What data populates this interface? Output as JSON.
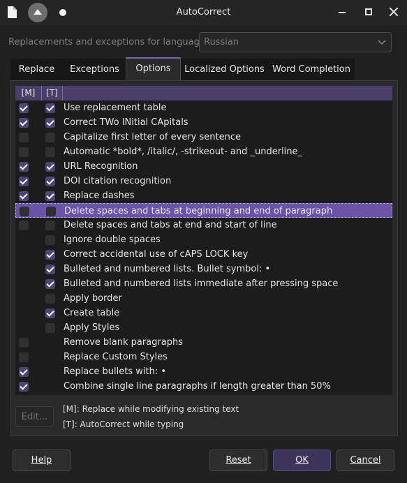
{
  "window": {
    "title": "AutoCorrect"
  },
  "language": {
    "label": "Replacements and exceptions for language:",
    "value": "Russian"
  },
  "tabs": [
    {
      "label": "Replace",
      "active": false
    },
    {
      "label": "Exceptions",
      "active": false
    },
    {
      "label": "Options",
      "active": true
    },
    {
      "label": "Localized Options",
      "active": false
    },
    {
      "label": "Word Completion",
      "active": false
    }
  ],
  "options": {
    "col_m": "[M]",
    "col_t": "[T]",
    "rows": [
      {
        "label": "Use replacement table",
        "m": true,
        "t": true
      },
      {
        "label": "Correct TWo INitial CApitals",
        "m": true,
        "t": true
      },
      {
        "label": "Capitalize first letter of every sentence",
        "m": false,
        "t": false
      },
      {
        "label": "Automatic *bold*, /italic/, -strikeout- and _underline_",
        "m": false,
        "t": false
      },
      {
        "label": "URL Recognition",
        "m": true,
        "t": true
      },
      {
        "label": "DOI citation recognition",
        "m": true,
        "t": true
      },
      {
        "label": "Replace dashes",
        "m": true,
        "t": true
      },
      {
        "label": "Delete spaces and tabs at beginning and end of paragraph",
        "m": false,
        "t": false,
        "selected": true
      },
      {
        "label": "Delete spaces and tabs at end and start of line",
        "m": false,
        "t": false
      },
      {
        "label": "Ignore double spaces",
        "m": null,
        "t": false
      },
      {
        "label": "Correct accidental use of cAPS LOCK key",
        "m": null,
        "t": true
      },
      {
        "label": "Bulleted and numbered lists. Bullet symbol: •",
        "m": null,
        "t": true
      },
      {
        "label": "Bulleted and numbered lists immediate after pressing space",
        "m": null,
        "t": true
      },
      {
        "label": "Apply border",
        "m": null,
        "t": false
      },
      {
        "label": "Create table",
        "m": null,
        "t": true
      },
      {
        "label": "Apply Styles",
        "m": null,
        "t": false
      },
      {
        "label": "Remove blank paragraphs",
        "m": false,
        "t": null
      },
      {
        "label": "Replace Custom Styles",
        "m": false,
        "t": null
      },
      {
        "label": "Replace bullets with: •",
        "m": true,
        "t": null
      },
      {
        "label": "Combine single line paragraphs if length greater than 50%",
        "m": true,
        "t": null
      }
    ],
    "edit_label": "Edit...",
    "legend_m": "[M]: Replace while modifying existing text",
    "legend_t": "[T]: AutoCorrect while typing"
  },
  "buttons": {
    "help": "Help",
    "reset": "Reset",
    "ok": "OK",
    "cancel": "Cancel"
  },
  "colors": {
    "accent": "#6b53a8",
    "checkbox_on": "#4f4478",
    "background": "#202020"
  }
}
